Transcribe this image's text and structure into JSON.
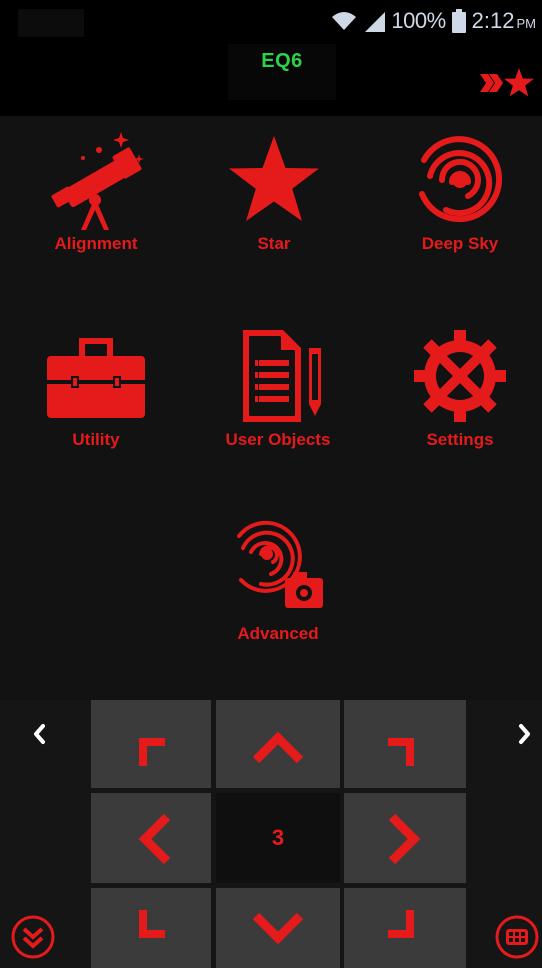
{
  "status_bar": {
    "battery_percent": "100%",
    "time": "2:12",
    "ampm": "PM",
    "icons": [
      "wifi-icon",
      "signal-icon",
      "battery-icon"
    ]
  },
  "header": {
    "title": "EQ6",
    "title_color": "#2ed14a",
    "favorite_icon": "double-chevron-star-icon"
  },
  "accent_color": "#e51b1b",
  "menu": {
    "alignment": "Alignment",
    "star": "Star",
    "deep_sky": "Deep Sky",
    "utility": "Utility",
    "user_objects": "User Objects",
    "settings": "Settings",
    "advanced": "Advanced"
  },
  "controller": {
    "speed": "3",
    "prev_icon": "chevron-left-icon",
    "next_icon": "chevron-right-icon",
    "collapse_icon": "double-chevron-down-circle-icon",
    "keypad_icon": "keypad-circle-icon"
  }
}
